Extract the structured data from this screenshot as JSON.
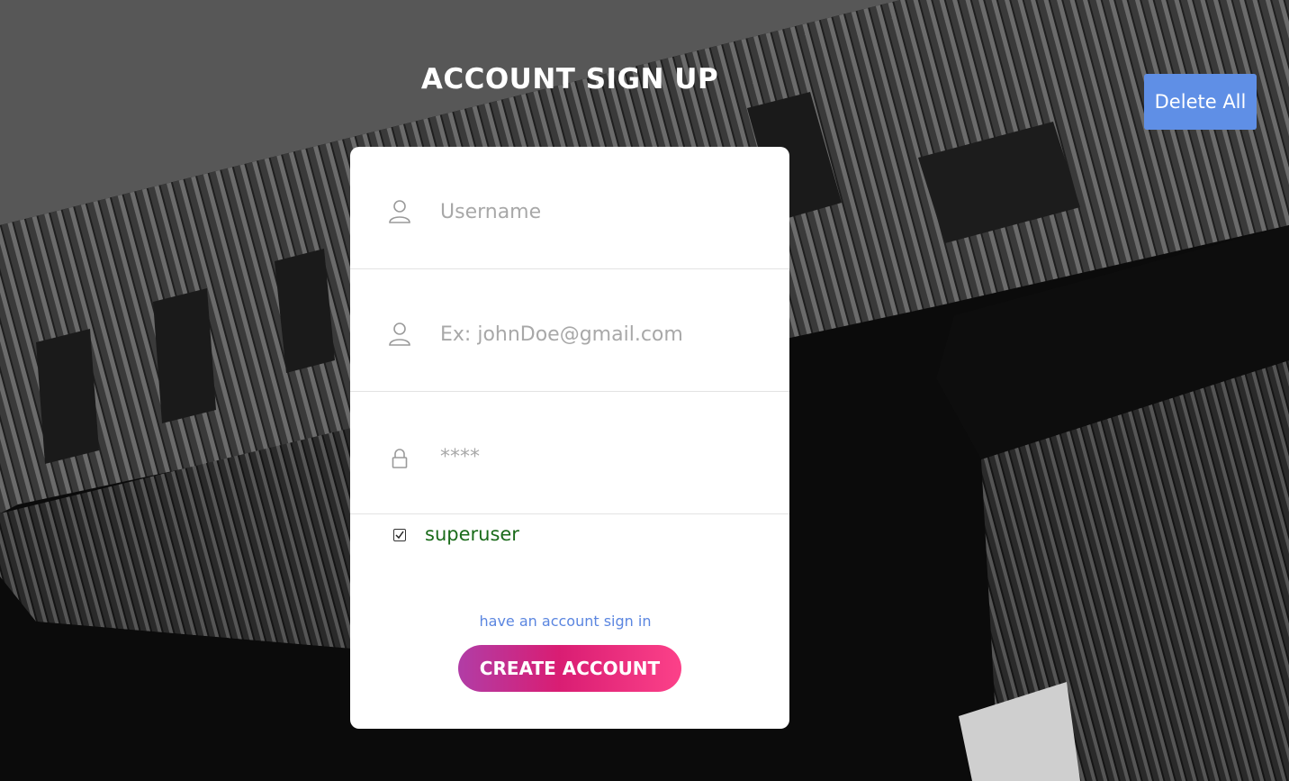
{
  "page": {
    "title": "ACCOUNT SIGN UP"
  },
  "toolbar": {
    "delete_all_label": "Delete All"
  },
  "form": {
    "username": {
      "placeholder": "Username",
      "value": "",
      "icon": "user-icon"
    },
    "email": {
      "placeholder": "Ex: johnDoe@gmail.com",
      "value": "",
      "icon": "user-icon"
    },
    "password": {
      "placeholder": "****",
      "value": "",
      "icon": "lock-icon"
    },
    "superuser": {
      "label": "superuser",
      "checked": true
    },
    "signin_link": "have an account sign in",
    "submit_label": "CREATE ACCOUNT"
  },
  "colors": {
    "delete_button": "#5f8fe6",
    "link": "#5b86e0",
    "checkbox_label": "#1a6b1a",
    "submit_gradient_start": "#b13da6",
    "submit_gradient_mid": "#d91d73",
    "submit_gradient_end": "#fc4189"
  }
}
